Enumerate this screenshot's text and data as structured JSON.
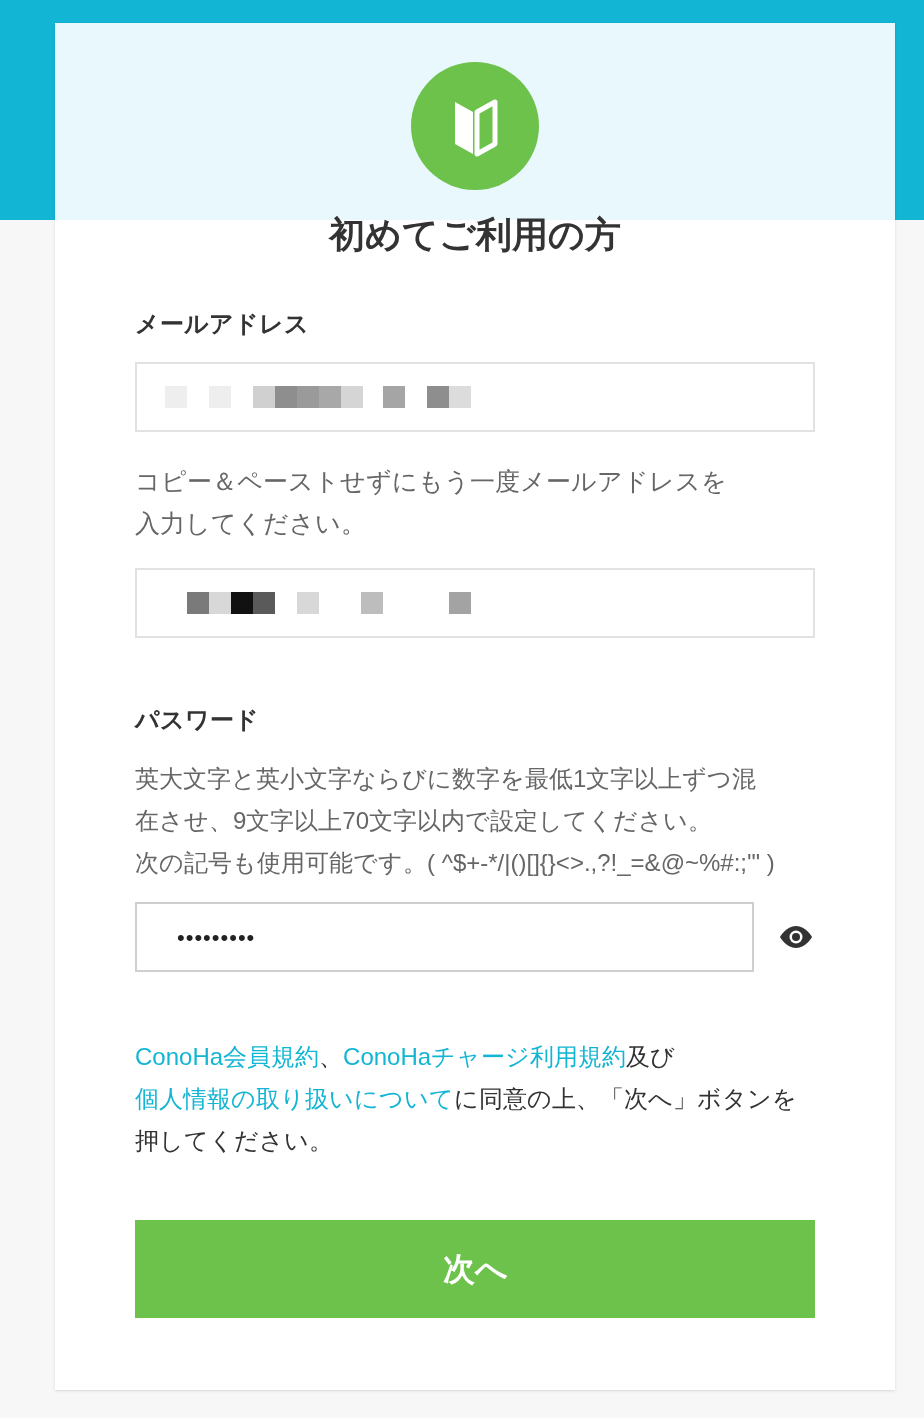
{
  "title": "初めてご利用の方",
  "email": {
    "label": "メールアドレス",
    "kind": "mosaic"
  },
  "confirm_hint": {
    "lines": [
      "コピー＆ペーストせずにもう一度メールアドレスを",
      "入力してください。"
    ]
  },
  "email_confirm": {
    "kind": "mosaic"
  },
  "password": {
    "label": "パスワード",
    "lines": [
      "英大文字と英小文字ならびに数字を最低1文字以上ずつ混",
      "在させ、9文字以上70文字以内で設定してください。",
      "次の記号も使用可能です。( ^$+-*/|()[]{}<>.,?!_=&@~%#:;'\" )"
    ],
    "value": "•••••••••"
  },
  "consent": [
    {
      "text": "ConoHa会員規約",
      "link": true
    },
    {
      "text": "、",
      "link": false
    },
    {
      "text": "ConoHaチャージ利用規約",
      "link": true
    },
    {
      "text": "及び",
      "link": false
    },
    {
      "text": "個人情報の取り扱いについて",
      "link": true
    },
    {
      "text": "に同意の上、「次へ」ボタンを押してください。",
      "link": false
    }
  ],
  "next_button": "次へ"
}
